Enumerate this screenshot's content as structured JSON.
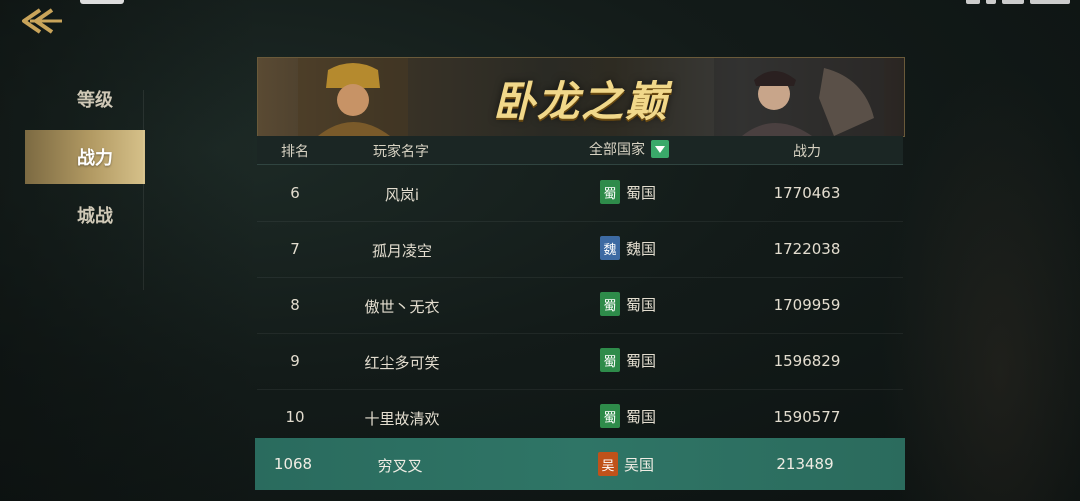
{
  "nav": {
    "items": [
      {
        "label": "等级",
        "active": false
      },
      {
        "label": "战力",
        "active": true
      },
      {
        "label": "城战",
        "active": false
      }
    ]
  },
  "banner": {
    "title": "卧龙之巅"
  },
  "table": {
    "headers": {
      "rank": "排名",
      "name": "玩家名字",
      "nation": "全部国家",
      "power": "战力"
    },
    "rows": [
      {
        "rank": "6",
        "name": "风岚i",
        "flag": "蜀",
        "nation": "蜀国",
        "power": "1770463"
      },
      {
        "rank": "7",
        "name": "孤月凌空",
        "flag": "魏",
        "nation": "魏国",
        "power": "1722038"
      },
      {
        "rank": "8",
        "name": "傲世丶无衣",
        "flag": "蜀",
        "nation": "蜀国",
        "power": "1709959"
      },
      {
        "rank": "9",
        "name": "红尘多可笑",
        "flag": "蜀",
        "nation": "蜀国",
        "power": "1596829"
      },
      {
        "rank": "10",
        "name": "十里故清欢",
        "flag": "蜀",
        "nation": "蜀国",
        "power": "1590577"
      }
    ]
  },
  "self": {
    "rank": "1068",
    "name": "穷叉叉",
    "flag": "吴",
    "nation": "吴国",
    "power": "213489"
  },
  "colors": {
    "accent_gold": "#d6c18a",
    "self_row": "#2f7566",
    "shu": "#2e8b4a",
    "wei": "#3d6aa3",
    "wu": "#c0521a"
  },
  "icons": [
    "back-arrow-icon",
    "dropdown-arrow-icon",
    "nation-flag-icon"
  ]
}
